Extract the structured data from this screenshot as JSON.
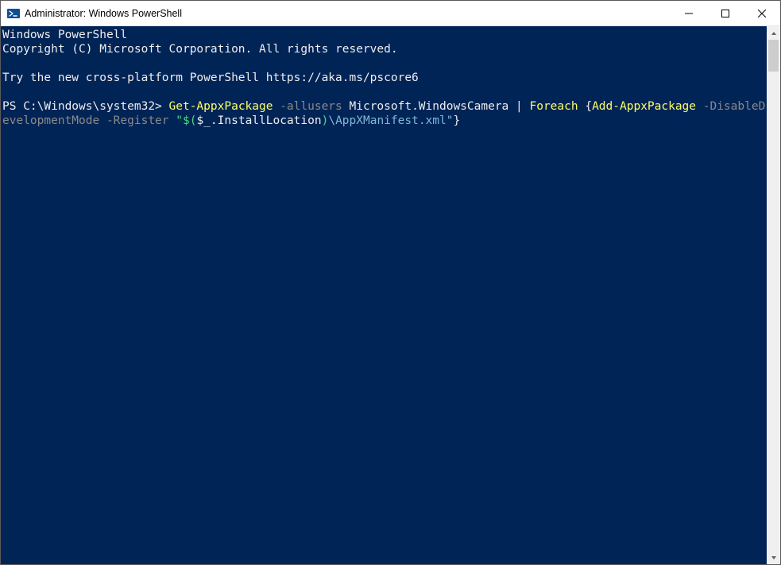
{
  "window": {
    "title": "Administrator: Windows PowerShell"
  },
  "terminal": {
    "banner_line1": "Windows PowerShell",
    "banner_line2": "Copyright (C) Microsoft Corporation. All rights reserved.",
    "info_line": "Try the new cross-platform PowerShell https://aka.ms/pscore6",
    "prompt": "PS C:\\Windows\\system32> ",
    "cmd": {
      "t1": "Get-AppxPackage",
      "p1": " -allusers ",
      "arg1": "Microsoft.WindowsCamera ",
      "pipe": "| ",
      "t2": "Foreach ",
      "brace_open": "{",
      "t3": "Add-AppxPackage",
      "p2": " -DisableDevelopmentMode -Register ",
      "s_open": "\"$(",
      "var": "$_",
      "prop": ".InstallLocation",
      "s_mid": ")",
      "path": "\\AppXManifest.xml\"",
      "brace_close": "}"
    }
  }
}
